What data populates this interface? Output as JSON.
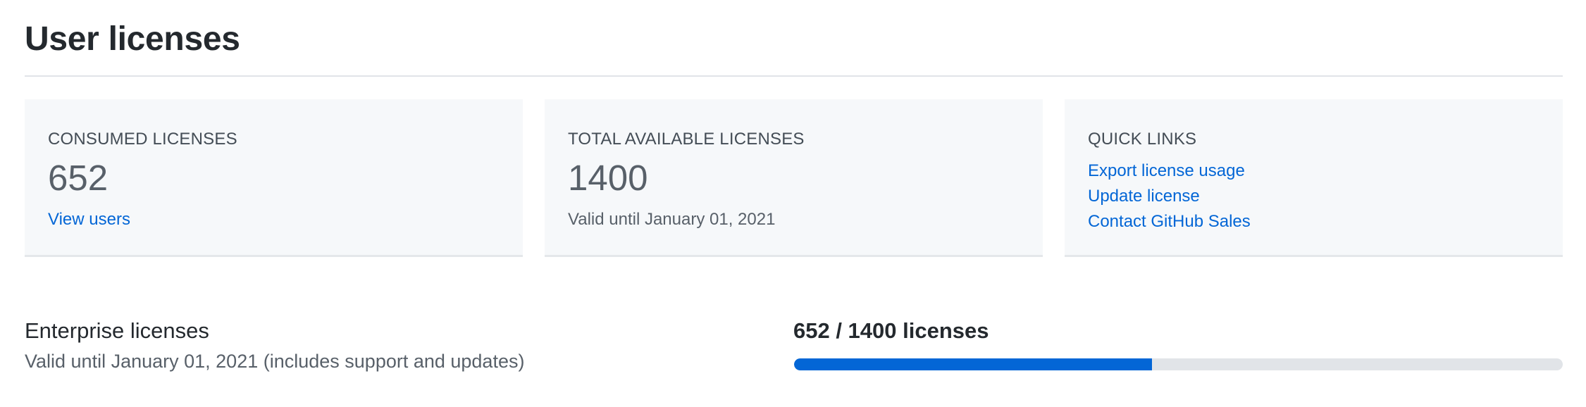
{
  "page": {
    "title": "User licenses"
  },
  "cards": {
    "consumed": {
      "heading": "CONSUMED LICENSES",
      "value": "652",
      "link": "View users"
    },
    "total": {
      "heading": "TOTAL AVAILABLE LICENSES",
      "value": "1400",
      "valid_until": "Valid until January 01, 2021"
    },
    "quick_links": {
      "heading": "QUICK LINKS",
      "items": [
        "Export license usage",
        "Update license",
        "Contact GitHub Sales"
      ]
    }
  },
  "enterprise": {
    "title": "Enterprise licenses",
    "subtitle": "Valid until January 01, 2021 (includes support and updates)",
    "usage_label": "652 / 1400 licenses",
    "consumed": 652,
    "total": 1400
  },
  "colors": {
    "link": "#0366d6",
    "progress_fill": "#0366d6",
    "progress_track": "#e1e4e8",
    "card_background": "#f6f8fa"
  }
}
